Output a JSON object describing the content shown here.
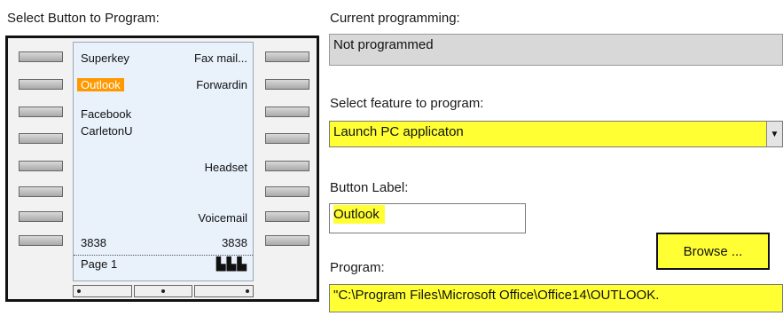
{
  "left": {
    "title": "Select Button to Program:",
    "screen": {
      "left_labels": [
        "Superkey",
        "Outlook",
        "Facebook",
        "CarletonU"
      ],
      "right_labels": [
        "Fax mail...",
        "Forwardin",
        "Headset",
        "Voicemail"
      ],
      "bottom_left": "3838",
      "bottom_right": "3838",
      "page_label": "Page 1",
      "page_icons": "▙▙▙"
    }
  },
  "right": {
    "current_label": "Current programming:",
    "current_value": "Not programmed",
    "feature_label": "Select feature to program:",
    "feature_value": "Launch PC applicaton",
    "button_label_label": "Button Label:",
    "button_label_value": "Outlook",
    "browse_label": "Browse ...",
    "program_label": "Program:",
    "program_value": "\"C:\\Program Files\\Microsoft Office\\Office14\\OUTLOOK."
  },
  "colors": {
    "highlight": "#ffff33",
    "selected_key": "#ff9900"
  }
}
